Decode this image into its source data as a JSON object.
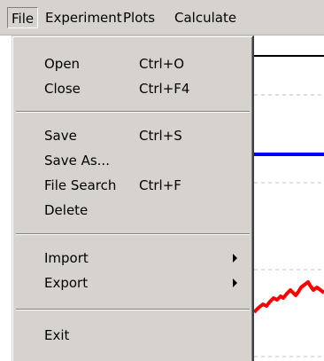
{
  "menubar": {
    "items": [
      {
        "label": "File"
      },
      {
        "label": "Experiment"
      },
      {
        "label": "Plots"
      },
      {
        "label": "Calculate"
      }
    ]
  },
  "file_menu": {
    "items": [
      {
        "label": "Open",
        "shortcut": "Ctrl+O"
      },
      {
        "label": "Close",
        "shortcut": "Ctrl+F4"
      },
      {
        "label": "Save",
        "shortcut": "Ctrl+S"
      },
      {
        "label": "Save As..."
      },
      {
        "label": "File Search",
        "shortcut": "Ctrl+F"
      },
      {
        "label": "Delete"
      },
      {
        "label": "Import",
        "submenu": true
      },
      {
        "label": "Export",
        "submenu": true
      },
      {
        "label": "Exit"
      }
    ]
  },
  "colors": {
    "menu_bg": "#d6d3ce",
    "blue_trace": "#0000ff",
    "red_trace": "#ff0000",
    "grid": "#c0c0c0"
  }
}
